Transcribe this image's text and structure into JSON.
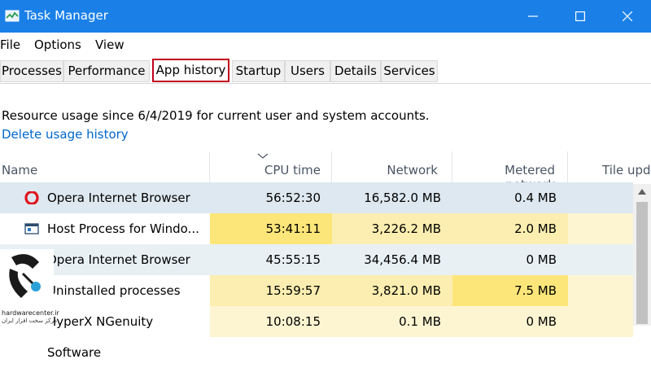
{
  "window": {
    "title": "Task Manager"
  },
  "colors": {
    "titlebar": "#1a80e8",
    "active_tab_border": "#c0001c",
    "link": "#0066cc",
    "heat_high": "#fce67a",
    "heat_mid": "#fbeeb0",
    "heat_low": "#fdf5d2",
    "selected_row": "#dde8f0"
  },
  "menu": {
    "items": [
      "File",
      "Options",
      "View"
    ]
  },
  "tabs": [
    {
      "label": "Processes",
      "active": false
    },
    {
      "label": "Performance",
      "active": false
    },
    {
      "label": "App history",
      "active": true
    },
    {
      "label": "Startup",
      "active": false
    },
    {
      "label": "Users",
      "active": false
    },
    {
      "label": "Details",
      "active": false
    },
    {
      "label": "Services",
      "active": false
    }
  ],
  "info": {
    "text": "Resource usage since 6/4/2019 for current user and system accounts.",
    "delete_link": "Delete usage history"
  },
  "table": {
    "headers": [
      "Name",
      "CPU time",
      "Network",
      "Metered network",
      "Tile upd"
    ],
    "sorted_column": "CPU time",
    "rows": [
      {
        "icon": "opera-icon",
        "name": "Opera Internet Browser",
        "cpu": "56:52:30",
        "network": "16,582.0 MB",
        "metered": "0.4 MB",
        "tile": "",
        "selected": true
      },
      {
        "icon": "window-app-icon",
        "name": "Host Process for Windo...",
        "cpu": "53:41:11",
        "network": "3,226.2 MB",
        "metered": "2.0 MB",
        "tile": ""
      },
      {
        "icon": "opera-icon",
        "name": "Opera Internet Browser",
        "cpu": "45:55:15",
        "network": "34,456.4 MB",
        "metered": "0 MB",
        "tile": ""
      },
      {
        "icon": "",
        "name": "Uninstalled processes",
        "cpu": "15:59:57",
        "network": "3,821.0 MB",
        "metered": "7.5 MB",
        "tile": ""
      },
      {
        "icon": "",
        "name": "HyperX NGenuity Software",
        "cpu": "10:08:15",
        "network": "0.1 MB",
        "metered": "0 MB",
        "tile": ""
      }
    ]
  },
  "watermark": {
    "name": "hardwarecenter.ir",
    "subtitle": "مرکز سخت افزار ایران"
  }
}
